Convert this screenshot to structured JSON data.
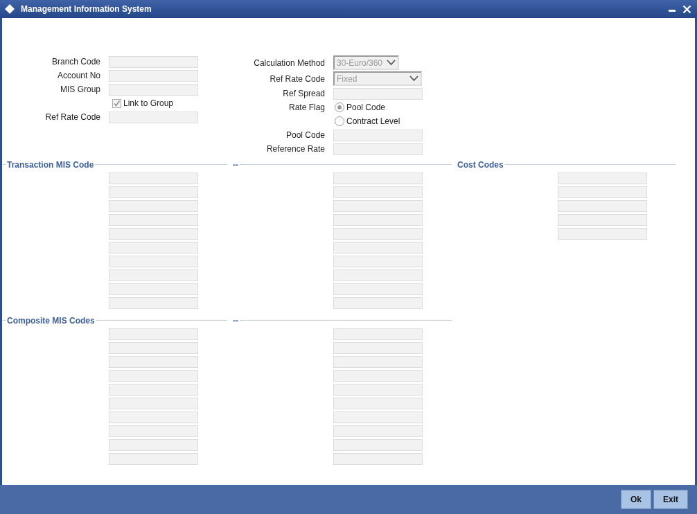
{
  "window": {
    "title": "Management Information System"
  },
  "left_form": [
    {
      "label": "Branch Code",
      "kind": "text"
    },
    {
      "label": "Account No",
      "kind": "text"
    },
    {
      "label": "MIS Group",
      "kind": "text"
    },
    {
      "label": "Link to Group",
      "kind": "checkbox",
      "checked": true
    },
    {
      "label": "Ref Rate Code",
      "kind": "text"
    }
  ],
  "right_form": [
    {
      "label": "Calculation Method",
      "kind": "select",
      "value": "30-Euro/360"
    },
    {
      "label": "Ref Rate Code",
      "kind": "select",
      "value": "Fixed"
    },
    {
      "label": "Ref Spread",
      "kind": "text"
    },
    {
      "label": "Rate Flag",
      "kind": "radio",
      "options": [
        {
          "label": "Pool Code",
          "selected": true
        },
        {
          "label": "Contract Level",
          "selected": false
        }
      ]
    },
    {
      "label": "Pool Code",
      "kind": "text"
    },
    {
      "label": "Reference Rate",
      "kind": "text"
    }
  ],
  "sections": [
    {
      "columns": [
        {
          "title": "Transaction MIS Code",
          "fields": [
            {
              "kind": "text"
            },
            {
              "kind": "text"
            },
            {
              "kind": "text"
            },
            {
              "kind": "text"
            },
            {
              "kind": "text"
            },
            {
              "kind": "text"
            },
            {
              "kind": "text"
            },
            {
              "kind": "text"
            },
            {
              "kind": "text"
            },
            {
              "kind": "text"
            }
          ]
        },
        {
          "title": "--",
          "fields": [
            {
              "kind": "text"
            },
            {
              "kind": "text"
            },
            {
              "kind": "text"
            },
            {
              "kind": "text"
            },
            {
              "kind": "text"
            },
            {
              "kind": "text"
            },
            {
              "kind": "text"
            },
            {
              "kind": "text"
            },
            {
              "kind": "text"
            },
            {
              "kind": "text"
            }
          ]
        },
        {
          "title": "Cost Codes",
          "fields": [
            {
              "kind": "text"
            },
            {
              "kind": "text"
            },
            {
              "kind": "text"
            },
            {
              "kind": "text"
            },
            {
              "kind": "text"
            }
          ]
        }
      ]
    },
    {
      "columns": [
        {
          "title": "Composite MIS Codes",
          "fields": [
            {
              "kind": "text"
            },
            {
              "kind": "text"
            },
            {
              "kind": "text"
            },
            {
              "kind": "text"
            },
            {
              "kind": "text"
            },
            {
              "kind": "text"
            },
            {
              "kind": "text"
            },
            {
              "kind": "text"
            },
            {
              "kind": "text"
            },
            {
              "kind": "text"
            }
          ]
        },
        {
          "title": "--",
          "fields": [
            {
              "kind": "text"
            },
            {
              "kind": "text"
            },
            {
              "kind": "text"
            },
            {
              "kind": "text"
            },
            {
              "kind": "text"
            },
            {
              "kind": "text"
            },
            {
              "kind": "text"
            },
            {
              "kind": "text"
            },
            {
              "kind": "text"
            },
            {
              "kind": "text"
            }
          ]
        }
      ]
    }
  ],
  "buttons": [
    "Ok",
    "Exit"
  ]
}
